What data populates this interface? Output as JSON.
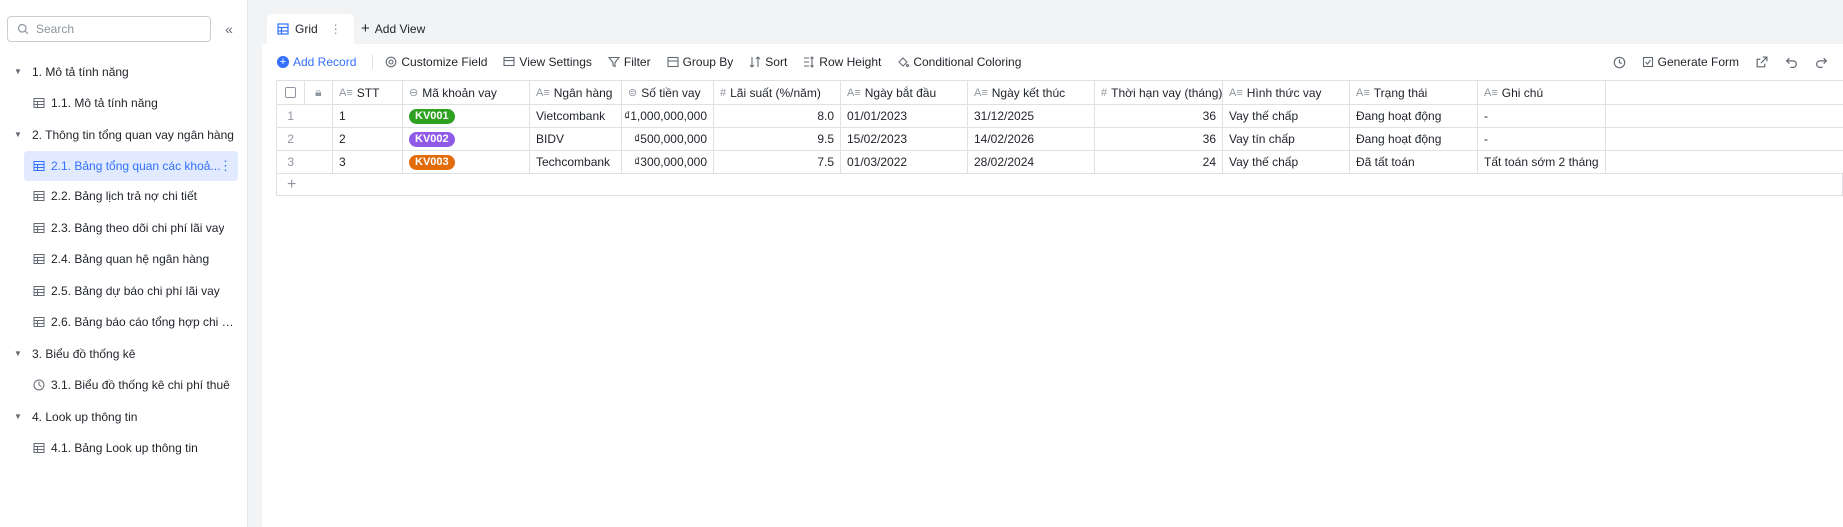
{
  "sidebar": {
    "search_placeholder": "Search",
    "collapse_icon": "double-chevron-left-icon",
    "groups": [
      {
        "label": "1. Mô tả tính năng",
        "items": [
          {
            "label": "1.1. Mô tả tính năng",
            "icon": "table-icon",
            "active": false
          }
        ]
      },
      {
        "label": "2. Thông tin tổng quan vay ngân hàng",
        "items": [
          {
            "label": "2.1. Bảng tổng quan các khoả...",
            "icon": "table-icon",
            "active": true
          },
          {
            "label": "2.2. Bảng lịch trả nợ chi tiết",
            "icon": "table-icon",
            "active": false
          },
          {
            "label": "2.3. Bảng theo dõi chi phí lãi vay",
            "icon": "table-icon",
            "active": false
          },
          {
            "label": "2.4. Bảng quan hệ ngân hàng",
            "icon": "table-icon",
            "active": false
          },
          {
            "label": "2.5. Bảng dự báo chi phí lãi vay",
            "icon": "table-icon",
            "active": false
          },
          {
            "label": "2.6. Bảng báo cáo tổng hợp chi p...",
            "icon": "table-icon",
            "active": false
          }
        ]
      },
      {
        "label": "3. Biểu đồ thống kê",
        "items": [
          {
            "label": "3.1. Biểu đồ thống kê chi phí thuê",
            "icon": "dashboard-icon",
            "active": false
          }
        ]
      },
      {
        "label": "4. Look up thông tin",
        "items": [
          {
            "label": "4.1. Bảng Look up thông tin",
            "icon": "table-icon",
            "active": false
          }
        ]
      }
    ]
  },
  "tabs": {
    "grid_label": "Grid",
    "add_view_label": "Add View"
  },
  "toolbar": {
    "add_record": "Add Record",
    "customize_field": "Customize Field",
    "view_settings": "View Settings",
    "filter": "Filter",
    "group_by": "Group By",
    "sort": "Sort",
    "row_height": "Row Height",
    "conditional_coloring": "Conditional Coloring",
    "generate_form": "Generate Form"
  },
  "table": {
    "columns": {
      "stt": "STT",
      "ma": "Mã khoản vay",
      "nh": "Ngân hàng",
      "st": "Số tiền vay",
      "ls": "Lãi suất (%/năm)",
      "bd": "Ngày bắt đầu",
      "kt": "Ngày kết thúc",
      "th": "Thời hạn vay (tháng)",
      "ht": "Hình thức vay",
      "tt": "Trạng thái",
      "gc": "Ghi chú"
    },
    "rows": [
      {
        "idx": "1",
        "stt": "1",
        "ma": "KV001",
        "nh": "Vietcombank",
        "st": "₫1,000,000,000",
        "ls": "8.0",
        "bd": "01/01/2023",
        "kt": "31/12/2025",
        "th": "36",
        "ht": "Vay thế chấp",
        "tt": "Đang hoạt động",
        "gc": "-"
      },
      {
        "idx": "2",
        "stt": "2",
        "ma": "KV002",
        "nh": "BIDV",
        "st": "₫500,000,000",
        "ls": "9.5",
        "bd": "15/02/2023",
        "kt": "14/02/2026",
        "th": "36",
        "ht": "Vay tín chấp",
        "tt": "Đang hoạt động",
        "gc": "-"
      },
      {
        "idx": "3",
        "stt": "3",
        "ma": "KV003",
        "nh": "Techcombank",
        "st": "₫300,000,000",
        "ls": "7.5",
        "bd": "01/03/2022",
        "kt": "28/02/2024",
        "th": "24",
        "ht": "Vay thế chấp",
        "tt": "Đã tất toán",
        "gc": "Tất toán sớm 2 tháng"
      }
    ],
    "tag_colors": {
      "KV001": "#2ea121",
      "KV002": "#8f5ae8",
      "KV003": "#e26b0a"
    }
  },
  "colors": {
    "accent": "#3370ff",
    "active_bg": "#e1eaff"
  }
}
